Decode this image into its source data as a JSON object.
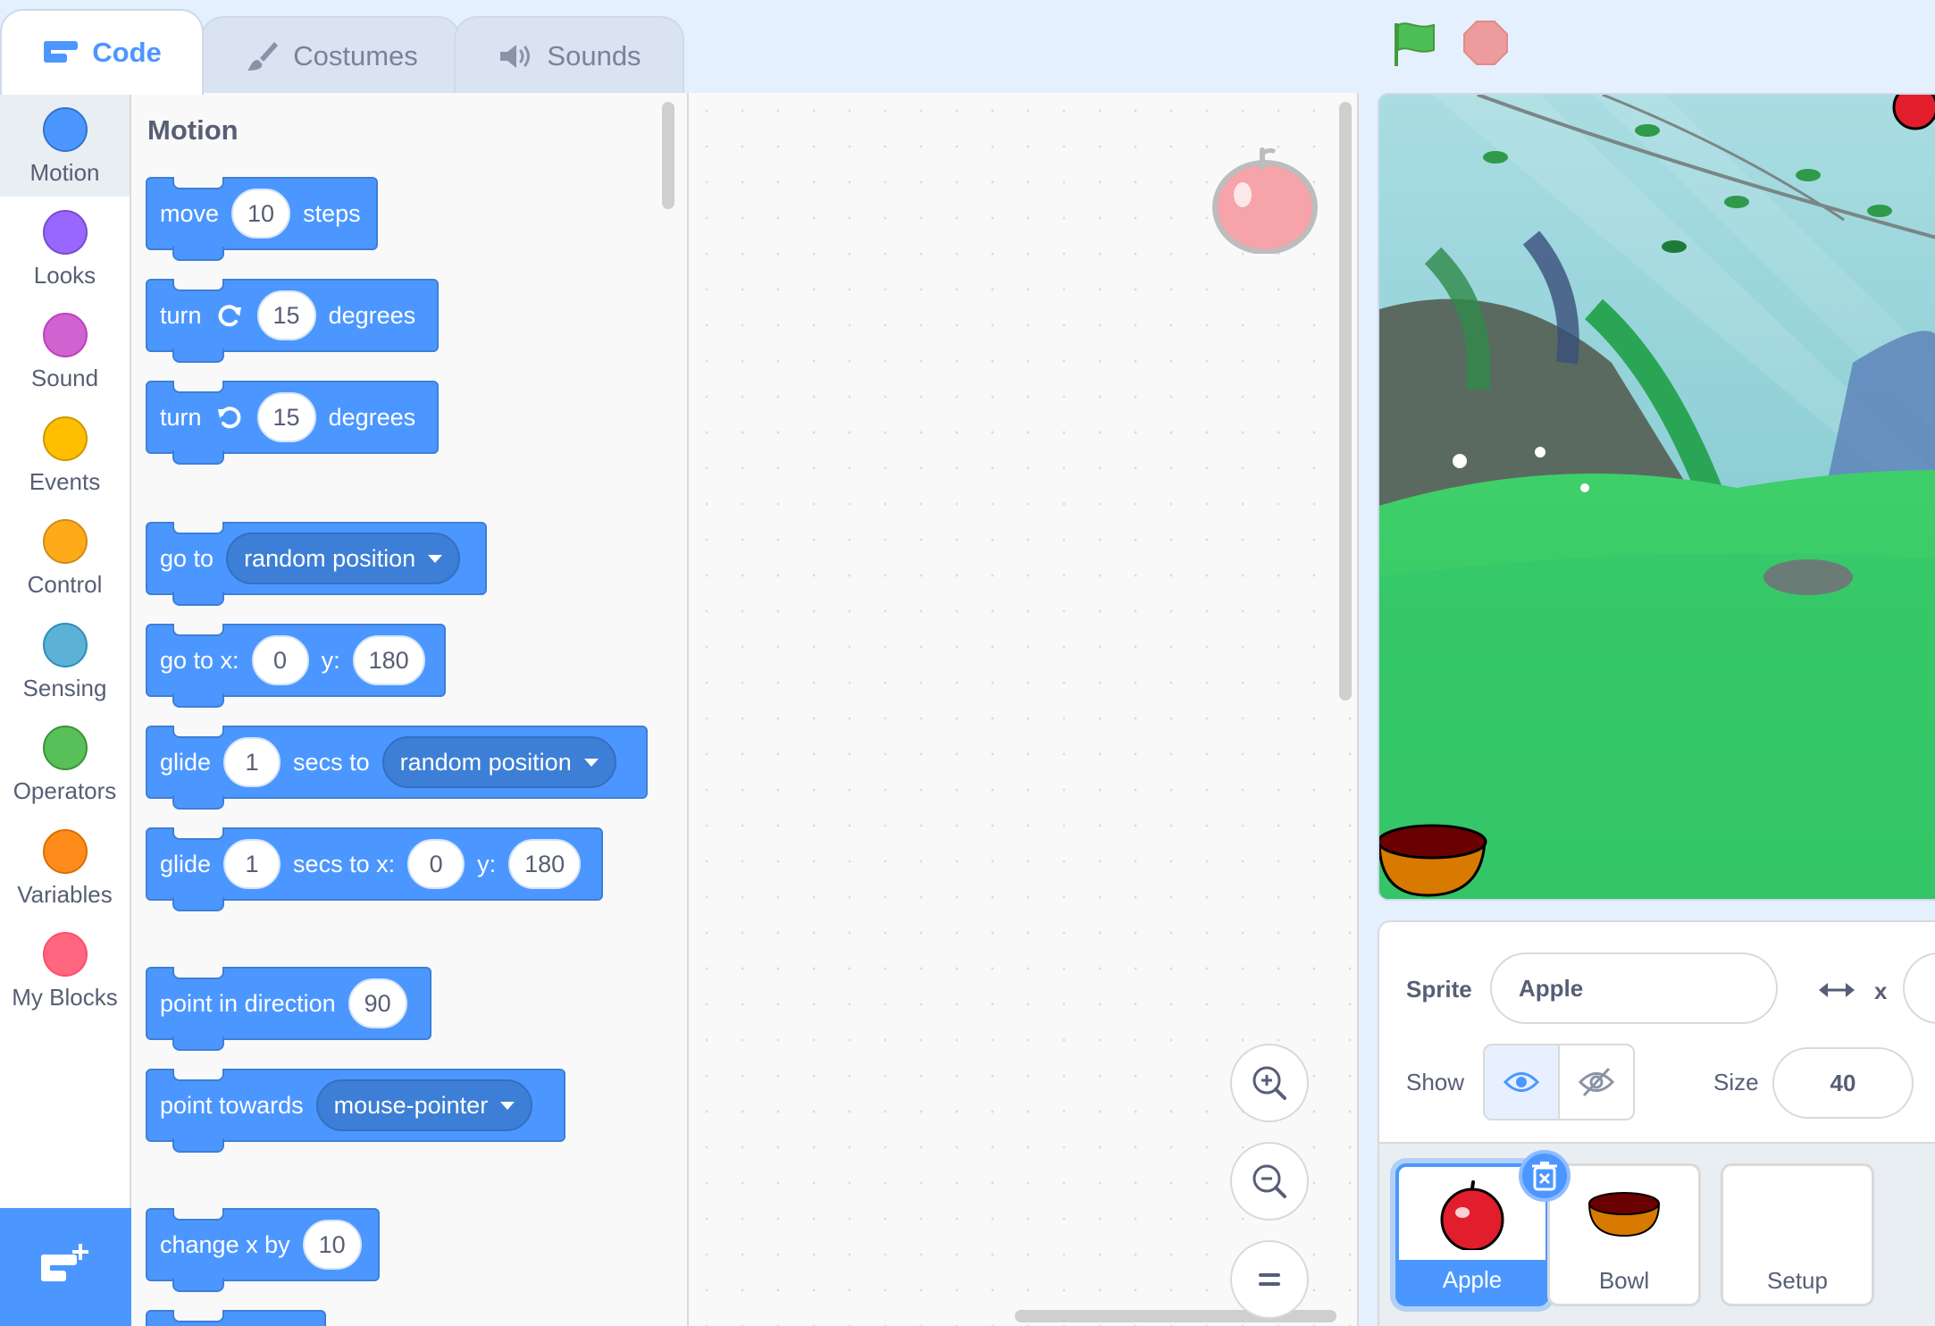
{
  "tabs": [
    {
      "label": "Code",
      "icon": "code-icon",
      "active": true
    },
    {
      "label": "Costumes",
      "icon": "brush-icon",
      "active": false
    },
    {
      "label": "Sounds",
      "icon": "speaker-icon",
      "active": false
    }
  ],
  "categories": [
    {
      "label": "Motion",
      "color": "#4c97ff"
    },
    {
      "label": "Looks",
      "color": "#9966ff"
    },
    {
      "label": "Sound",
      "color": "#cf63cf"
    },
    {
      "label": "Events",
      "color": "#ffbf00"
    },
    {
      "label": "Control",
      "color": "#ffab19"
    },
    {
      "label": "Sensing",
      "color": "#5cb1d6"
    },
    {
      "label": "Operators",
      "color": "#59c059"
    },
    {
      "label": "Variables",
      "color": "#ff8c1a"
    },
    {
      "label": "My Blocks",
      "color": "#ff6680"
    }
  ],
  "flyout": {
    "title": "Motion",
    "move": {
      "a": "move",
      "v": "10",
      "b": "steps"
    },
    "turn_right": {
      "a": "turn",
      "v": "15",
      "b": "degrees"
    },
    "turn_left": {
      "a": "turn",
      "v": "15",
      "b": "degrees"
    },
    "goto": {
      "a": "go to",
      "dd": "random position"
    },
    "goto_xy": {
      "a": "go to x:",
      "x": "0",
      "b": "y:",
      "y": "180"
    },
    "glide": {
      "a": "glide",
      "v": "1",
      "b": "secs to",
      "dd": "random position"
    },
    "glide_xy": {
      "a": "glide",
      "v": "1",
      "b": "secs to x:",
      "x": "0",
      "c": "y:",
      "y": "180"
    },
    "point_dir": {
      "a": "point in direction",
      "v": "90"
    },
    "point_towards": {
      "a": "point towards",
      "dd": "mouse-pointer"
    },
    "change_x": {
      "a": "change x by",
      "v": "10"
    }
  },
  "sprite_info": {
    "sprite_label": "Sprite",
    "sprite_name": "Apple",
    "x_label": "x",
    "show_label": "Show",
    "size_label": "Size",
    "size_value": "40"
  },
  "sprites": [
    {
      "name": "Apple",
      "selected": true
    },
    {
      "name": "Bowl",
      "selected": false
    },
    {
      "name": "Setup",
      "selected": false
    }
  ],
  "colors": {
    "motion": "#4c97ff",
    "accent": "#4c97ff",
    "flag": "#4cbf56",
    "stop": "#ec9c9c"
  }
}
